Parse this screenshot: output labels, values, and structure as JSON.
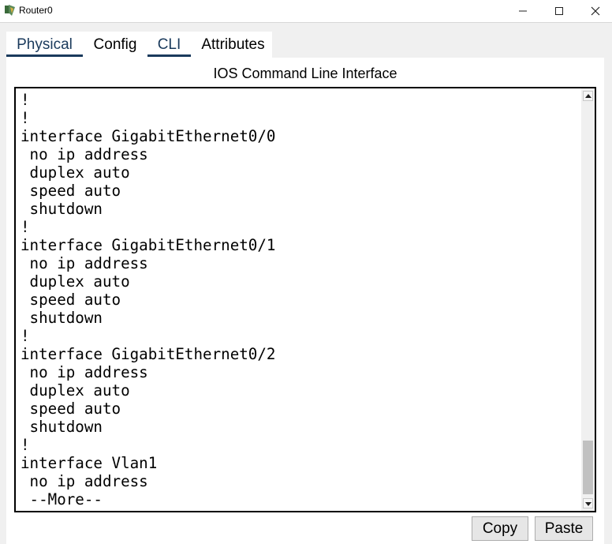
{
  "window": {
    "title": "Router0",
    "controls": {
      "minimize_icon": "minimize-icon",
      "maximize_icon": "maximize-icon",
      "close_icon": "close-icon"
    }
  },
  "tabs": [
    {
      "label": "Physical",
      "selected": false
    },
    {
      "label": "Config",
      "selected": false
    },
    {
      "label": "CLI",
      "selected": true
    },
    {
      "label": "Attributes",
      "selected": false
    }
  ],
  "cli": {
    "heading": "IOS Command Line Interface",
    "output": "!\n!\ninterface GigabitEthernet0/0\n no ip address\n duplex auto\n speed auto\n shutdown\n!\ninterface GigabitEthernet0/1\n no ip address\n duplex auto\n speed auto\n shutdown\n!\ninterface GigabitEthernet0/2\n no ip address\n duplex auto\n speed auto\n shutdown\n!\ninterface Vlan1\n no ip address\n --More--"
  },
  "buttons": {
    "copy": "Copy",
    "paste": "Paste"
  },
  "colors": {
    "tab_accent": "#1a3a5c",
    "background": "#f0f0f0",
    "panel": "#ffffff"
  }
}
